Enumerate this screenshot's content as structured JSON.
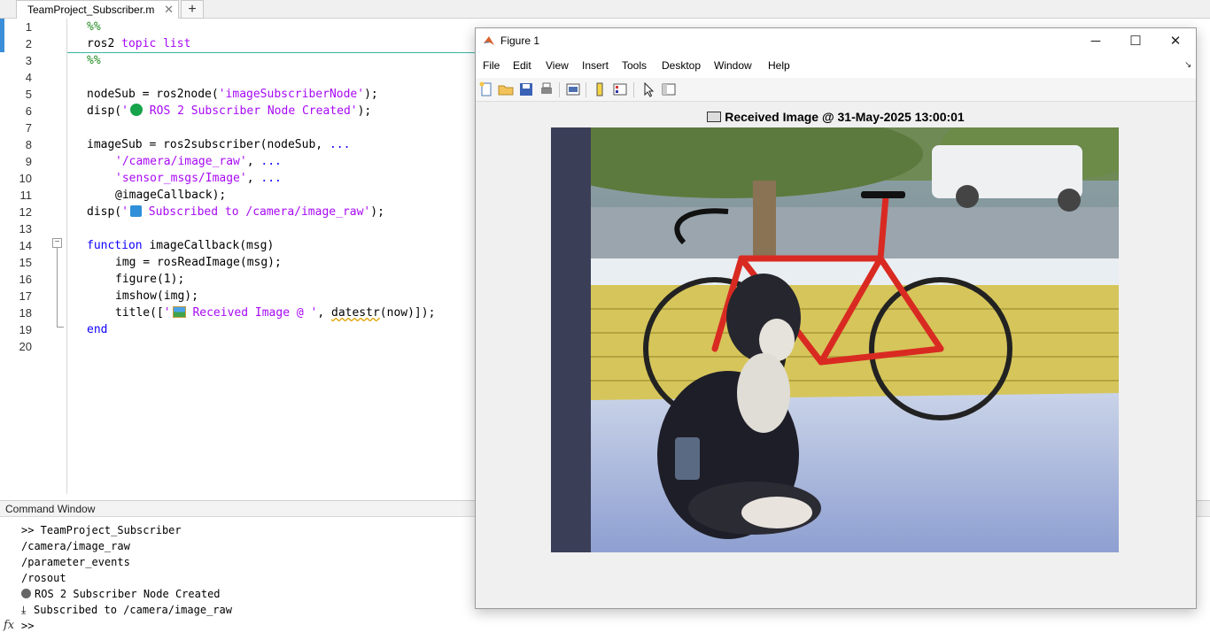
{
  "editor": {
    "tab_label": "TeamProject_Subscriber.m",
    "tab_close": "✕",
    "tab_add": "+",
    "lines": [
      {
        "n": "1"
      },
      {
        "n": "2"
      },
      {
        "n": "3"
      },
      {
        "n": "4"
      },
      {
        "n": "5"
      },
      {
        "n": "6"
      },
      {
        "n": "7"
      },
      {
        "n": "8"
      },
      {
        "n": "9"
      },
      {
        "n": "10"
      },
      {
        "n": "11"
      },
      {
        "n": "12"
      },
      {
        "n": "13"
      },
      {
        "n": "14"
      },
      {
        "n": "15"
      },
      {
        "n": "16"
      },
      {
        "n": "17"
      },
      {
        "n": "18"
      },
      {
        "n": "19"
      },
      {
        "n": "20"
      }
    ],
    "code": {
      "l1": "%%",
      "l2_cmd": "ros2",
      "l2_args": " topic list",
      "l3": "%%",
      "l5_a": "nodeSub = ros2node(",
      "l5_str": "'imageSubscriberNode'",
      "l5_b": ");",
      "l6_a": "disp(",
      "l6_str_a": "'",
      "l6_str_b": " ROS 2 Subscriber Node Created'",
      "l6_b": ");",
      "l8": "imageSub = ros2subscriber(nodeSub, ",
      "l8_dots": "...",
      "l9_str": "'/camera/image_raw'",
      "l9_b": ", ",
      "l9_dots": "...",
      "l10_str": "'sensor_msgs/Image'",
      "l10_b": ", ",
      "l10_dots": "...",
      "l11": "@imageCallback);",
      "l12_a": "disp(",
      "l12_str_a": "'",
      "l12_str_b": " Subscribed to /camera/image_raw'",
      "l12_b": ");",
      "l14_kw": "function",
      "l14_b": " imageCallback(msg)",
      "l15": "img = rosReadImage(msg);",
      "l16": "figure(1);",
      "l17": "imshow(img);",
      "l18_a": "title([",
      "l18_str_a": "'",
      "l18_str_b": " Received Image @ '",
      "l18_b": ", ",
      "l18_fn": "datestr",
      "l18_c": "(now)]);",
      "l19_kw": "end"
    },
    "emoji": {
      "green_circle": "#16a34a",
      "inbox_tray": "inbox-tray-icon",
      "picture": "framed-picture-icon"
    }
  },
  "command_window": {
    "header": "Command Window",
    "lines": [
      ">> TeamProject_Subscriber",
      "/camera/image_raw",
      "/parameter_events",
      "/rosout",
      "ROS 2 Subscriber Node Created",
      "Subscribed to /camera/image_raw"
    ],
    "prompt": ">>",
    "fx_label": "fx"
  },
  "figure": {
    "title": "Figure 1",
    "menus": [
      "File",
      "Edit",
      "View",
      "Insert",
      "Tools",
      "Desktop",
      "Window",
      "Help"
    ],
    "axes_title": "Received Image @ 31-May-2025 13:00:01",
    "colors": {
      "accent": "#3c8ed8",
      "string": "#a709f5",
      "keyword": "#0e00ff",
      "comment": "#228b22"
    }
  }
}
